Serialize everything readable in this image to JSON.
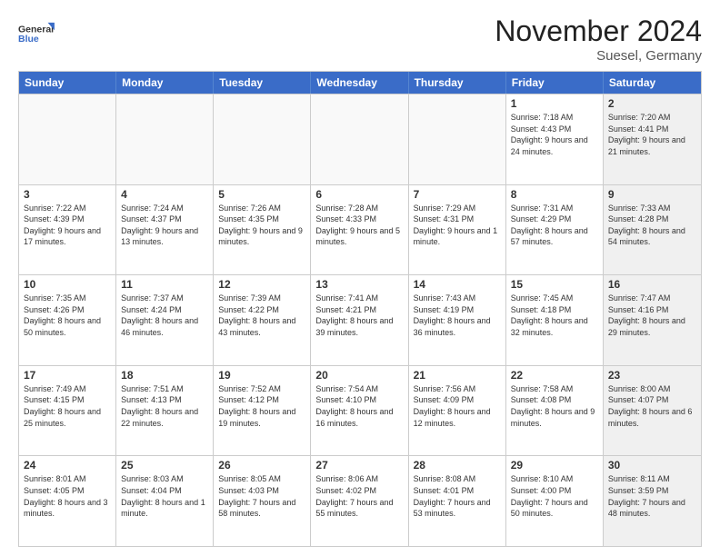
{
  "header": {
    "logo_line1": "General",
    "logo_line2": "Blue",
    "title": "November 2024",
    "subtitle": "Suesel, Germany"
  },
  "days_of_week": [
    "Sunday",
    "Monday",
    "Tuesday",
    "Wednesday",
    "Thursday",
    "Friday",
    "Saturday"
  ],
  "weeks": [
    [
      {
        "day": "",
        "info": "",
        "empty": true
      },
      {
        "day": "",
        "info": "",
        "empty": true
      },
      {
        "day": "",
        "info": "",
        "empty": true
      },
      {
        "day": "",
        "info": "",
        "empty": true
      },
      {
        "day": "",
        "info": "",
        "empty": true
      },
      {
        "day": "1",
        "info": "Sunrise: 7:18 AM\nSunset: 4:43 PM\nDaylight: 9 hours\nand 24 minutes.",
        "empty": false,
        "shaded": false
      },
      {
        "day": "2",
        "info": "Sunrise: 7:20 AM\nSunset: 4:41 PM\nDaylight: 9 hours\nand 21 minutes.",
        "empty": false,
        "shaded": true
      }
    ],
    [
      {
        "day": "3",
        "info": "Sunrise: 7:22 AM\nSunset: 4:39 PM\nDaylight: 9 hours\nand 17 minutes.",
        "empty": false,
        "shaded": false
      },
      {
        "day": "4",
        "info": "Sunrise: 7:24 AM\nSunset: 4:37 PM\nDaylight: 9 hours\nand 13 minutes.",
        "empty": false,
        "shaded": false
      },
      {
        "day": "5",
        "info": "Sunrise: 7:26 AM\nSunset: 4:35 PM\nDaylight: 9 hours\nand 9 minutes.",
        "empty": false,
        "shaded": false
      },
      {
        "day": "6",
        "info": "Sunrise: 7:28 AM\nSunset: 4:33 PM\nDaylight: 9 hours\nand 5 minutes.",
        "empty": false,
        "shaded": false
      },
      {
        "day": "7",
        "info": "Sunrise: 7:29 AM\nSunset: 4:31 PM\nDaylight: 9 hours\nand 1 minute.",
        "empty": false,
        "shaded": false
      },
      {
        "day": "8",
        "info": "Sunrise: 7:31 AM\nSunset: 4:29 PM\nDaylight: 8 hours\nand 57 minutes.",
        "empty": false,
        "shaded": false
      },
      {
        "day": "9",
        "info": "Sunrise: 7:33 AM\nSunset: 4:28 PM\nDaylight: 8 hours\nand 54 minutes.",
        "empty": false,
        "shaded": true
      }
    ],
    [
      {
        "day": "10",
        "info": "Sunrise: 7:35 AM\nSunset: 4:26 PM\nDaylight: 8 hours\nand 50 minutes.",
        "empty": false,
        "shaded": false
      },
      {
        "day": "11",
        "info": "Sunrise: 7:37 AM\nSunset: 4:24 PM\nDaylight: 8 hours\nand 46 minutes.",
        "empty": false,
        "shaded": false
      },
      {
        "day": "12",
        "info": "Sunrise: 7:39 AM\nSunset: 4:22 PM\nDaylight: 8 hours\nand 43 minutes.",
        "empty": false,
        "shaded": false
      },
      {
        "day": "13",
        "info": "Sunrise: 7:41 AM\nSunset: 4:21 PM\nDaylight: 8 hours\nand 39 minutes.",
        "empty": false,
        "shaded": false
      },
      {
        "day": "14",
        "info": "Sunrise: 7:43 AM\nSunset: 4:19 PM\nDaylight: 8 hours\nand 36 minutes.",
        "empty": false,
        "shaded": false
      },
      {
        "day": "15",
        "info": "Sunrise: 7:45 AM\nSunset: 4:18 PM\nDaylight: 8 hours\nand 32 minutes.",
        "empty": false,
        "shaded": false
      },
      {
        "day": "16",
        "info": "Sunrise: 7:47 AM\nSunset: 4:16 PM\nDaylight: 8 hours\nand 29 minutes.",
        "empty": false,
        "shaded": true
      }
    ],
    [
      {
        "day": "17",
        "info": "Sunrise: 7:49 AM\nSunset: 4:15 PM\nDaylight: 8 hours\nand 25 minutes.",
        "empty": false,
        "shaded": false
      },
      {
        "day": "18",
        "info": "Sunrise: 7:51 AM\nSunset: 4:13 PM\nDaylight: 8 hours\nand 22 minutes.",
        "empty": false,
        "shaded": false
      },
      {
        "day": "19",
        "info": "Sunrise: 7:52 AM\nSunset: 4:12 PM\nDaylight: 8 hours\nand 19 minutes.",
        "empty": false,
        "shaded": false
      },
      {
        "day": "20",
        "info": "Sunrise: 7:54 AM\nSunset: 4:10 PM\nDaylight: 8 hours\nand 16 minutes.",
        "empty": false,
        "shaded": false
      },
      {
        "day": "21",
        "info": "Sunrise: 7:56 AM\nSunset: 4:09 PM\nDaylight: 8 hours\nand 12 minutes.",
        "empty": false,
        "shaded": false
      },
      {
        "day": "22",
        "info": "Sunrise: 7:58 AM\nSunset: 4:08 PM\nDaylight: 8 hours\nand 9 minutes.",
        "empty": false,
        "shaded": false
      },
      {
        "day": "23",
        "info": "Sunrise: 8:00 AM\nSunset: 4:07 PM\nDaylight: 8 hours\nand 6 minutes.",
        "empty": false,
        "shaded": true
      }
    ],
    [
      {
        "day": "24",
        "info": "Sunrise: 8:01 AM\nSunset: 4:05 PM\nDaylight: 8 hours\nand 3 minutes.",
        "empty": false,
        "shaded": false
      },
      {
        "day": "25",
        "info": "Sunrise: 8:03 AM\nSunset: 4:04 PM\nDaylight: 8 hours\nand 1 minute.",
        "empty": false,
        "shaded": false
      },
      {
        "day": "26",
        "info": "Sunrise: 8:05 AM\nSunset: 4:03 PM\nDaylight: 7 hours\nand 58 minutes.",
        "empty": false,
        "shaded": false
      },
      {
        "day": "27",
        "info": "Sunrise: 8:06 AM\nSunset: 4:02 PM\nDaylight: 7 hours\nand 55 minutes.",
        "empty": false,
        "shaded": false
      },
      {
        "day": "28",
        "info": "Sunrise: 8:08 AM\nSunset: 4:01 PM\nDaylight: 7 hours\nand 53 minutes.",
        "empty": false,
        "shaded": false
      },
      {
        "day": "29",
        "info": "Sunrise: 8:10 AM\nSunset: 4:00 PM\nDaylight: 7 hours\nand 50 minutes.",
        "empty": false,
        "shaded": false
      },
      {
        "day": "30",
        "info": "Sunrise: 8:11 AM\nSunset: 3:59 PM\nDaylight: 7 hours\nand 48 minutes.",
        "empty": false,
        "shaded": true
      }
    ]
  ]
}
